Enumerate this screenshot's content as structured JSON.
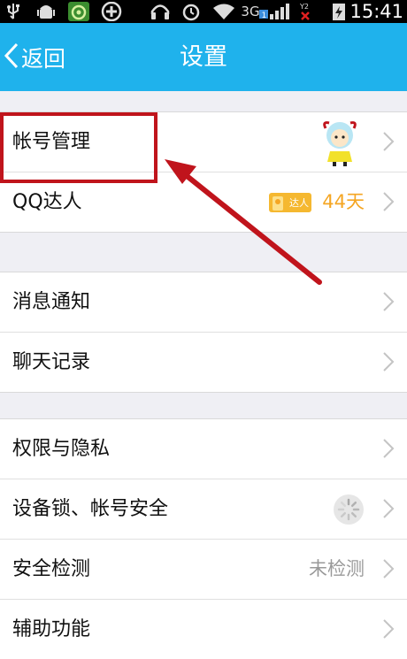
{
  "status_bar": {
    "time": "15:41",
    "network_label": "3G",
    "sim_badge": "1",
    "sim2_badge": "Y2",
    "icons": [
      "usb-icon",
      "android-debug-icon",
      "app-notify-icon",
      "add-circle-icon",
      "headset-icon",
      "alarm-icon",
      "wifi-icon",
      "signal-icon",
      "signal-no-sim-icon",
      "battery-charging-icon"
    ]
  },
  "header": {
    "back_label": "返回",
    "title": "设置"
  },
  "groups": [
    {
      "rows": [
        {
          "label": "帐号管理"
        },
        {
          "label": "QQ达人",
          "badge_text": "达人",
          "value": "44天"
        }
      ]
    },
    {
      "rows": [
        {
          "label": "消息通知"
        },
        {
          "label": "聊天记录"
        }
      ]
    },
    {
      "rows": [
        {
          "label": "权限与隐私"
        },
        {
          "label": "设备锁、帐号安全"
        },
        {
          "label": "安全检测",
          "value": "未检测"
        },
        {
          "label": "辅助功能"
        }
      ]
    }
  ],
  "colors": {
    "title_bar": "#1fb2ec",
    "annotation_red": "#c0141c",
    "qq_master_value": "#f5a623",
    "muted_value": "#999999"
  }
}
